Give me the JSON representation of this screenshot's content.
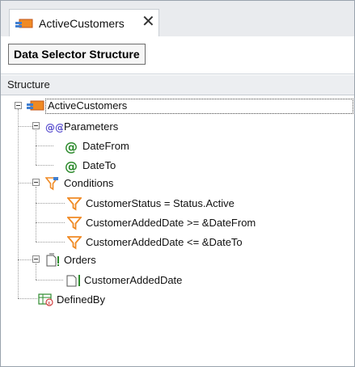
{
  "tab": {
    "title": "ActiveCustomers",
    "close_symbol": "✕"
  },
  "toolbar": {
    "button_label": "Data Selector Structure"
  },
  "column_header": "Structure",
  "tree": {
    "root": "ActiveCustomers",
    "parameters": {
      "label": "Parameters",
      "items": [
        "DateFrom",
        "DateTo"
      ]
    },
    "conditions": {
      "label": "Conditions",
      "items": [
        "CustomerStatus = Status.Active",
        "CustomerAddedDate >= &DateFrom",
        "CustomerAddedDate <= &DateTo"
      ]
    },
    "orders": {
      "label": "Orders",
      "items": [
        "CustomerAddedDate"
      ]
    },
    "defined_by": "DefinedBy"
  },
  "colors": {
    "accent_orange": "#e8682a",
    "param_green": "#2e8b2e",
    "params_purple": "#5a4fcf",
    "filter_orange": "#f08a24",
    "header_bg": "#eceef1"
  }
}
